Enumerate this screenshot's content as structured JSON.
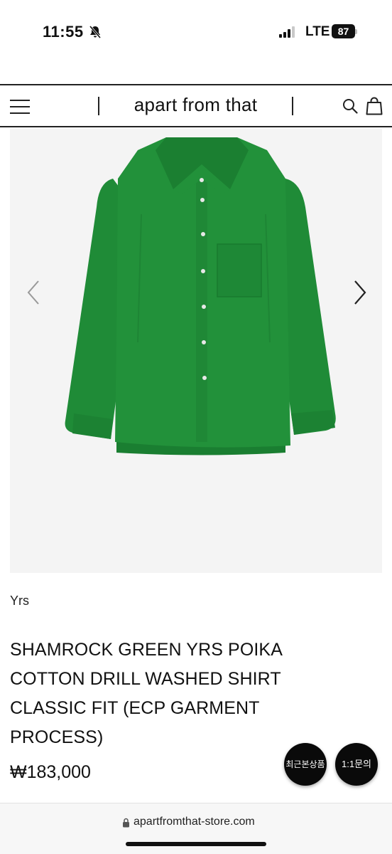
{
  "status_bar": {
    "time": "11:55",
    "network": "LTE",
    "battery": "87",
    "icons": [
      "bell-slash-icon",
      "signal-icon",
      "battery-icon"
    ]
  },
  "header": {
    "brand": "apart from that",
    "icons": [
      "menu-icon",
      "search-icon",
      "shopping-bag-icon"
    ]
  },
  "gallery": {
    "icons": [
      "chevron-left-icon",
      "chevron-right-icon"
    ],
    "shirt_color": "#1e8a36"
  },
  "product": {
    "brand": "Yrs",
    "title": "SHAMROCK GREEN YRS POIKA COTTON DRILL WASHED SHIRT CLASSIC FIT (ECP GARMENT PROCESS)",
    "price": "₩183,000"
  },
  "floating_buttons": {
    "recent": "최근본상품",
    "inquiry": "1:1문의"
  },
  "browser": {
    "url": "apartfromthat-store.com"
  },
  "colors": {
    "background": "#ffffff",
    "image_bg": "#f4f4f4",
    "floating_button": "#0a0a0a"
  }
}
